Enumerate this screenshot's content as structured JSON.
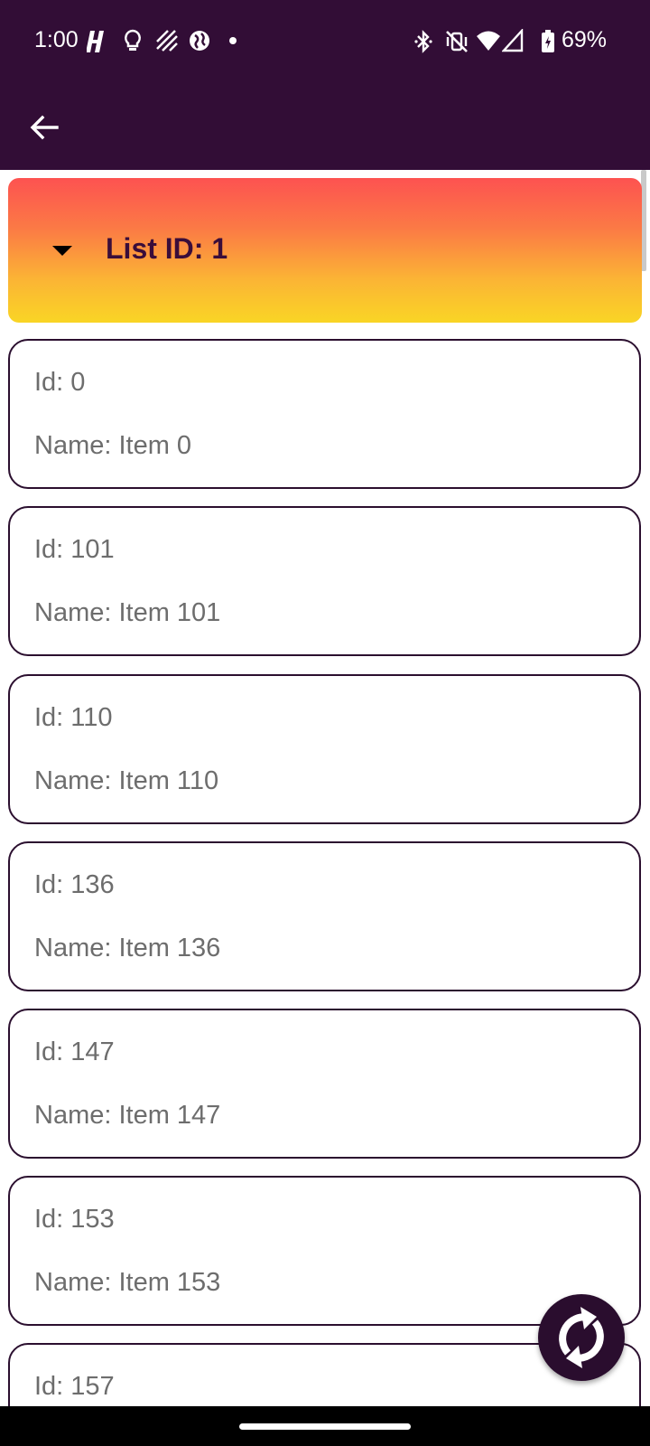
{
  "status_bar": {
    "time": "1:00",
    "battery": "69%",
    "icons_left": [
      "app-h-icon",
      "lightbulb-icon",
      "stripes-icon",
      "globe-icon",
      "dot-icon"
    ],
    "icons_right": [
      "bluetooth-icon",
      "vibrate-off-icon",
      "wifi-icon",
      "cell-signal-icon",
      "battery-charging-icon"
    ]
  },
  "appbar": {
    "back_icon": "arrow-back-icon",
    "background": "#320d36"
  },
  "list_header": {
    "title": "List ID: 1",
    "caret_icon": "caret-down-icon",
    "gradient": [
      "#fd5251",
      "#f9d525"
    ]
  },
  "items": [
    {
      "id": "Id: 0",
      "name": "Name: Item 0"
    },
    {
      "id": "Id: 101",
      "name": "Name: Item 101"
    },
    {
      "id": "Id: 110",
      "name": "Name: Item 110"
    },
    {
      "id": "Id: 136",
      "name": "Name: Item 136"
    },
    {
      "id": "Id: 147",
      "name": "Name: Item 147"
    },
    {
      "id": "Id: 153",
      "name": "Name: Item 153"
    },
    {
      "id": "Id: 157",
      "name": ""
    }
  ],
  "fab": {
    "icon": "refresh-icon",
    "color": "#2a0d2e"
  }
}
